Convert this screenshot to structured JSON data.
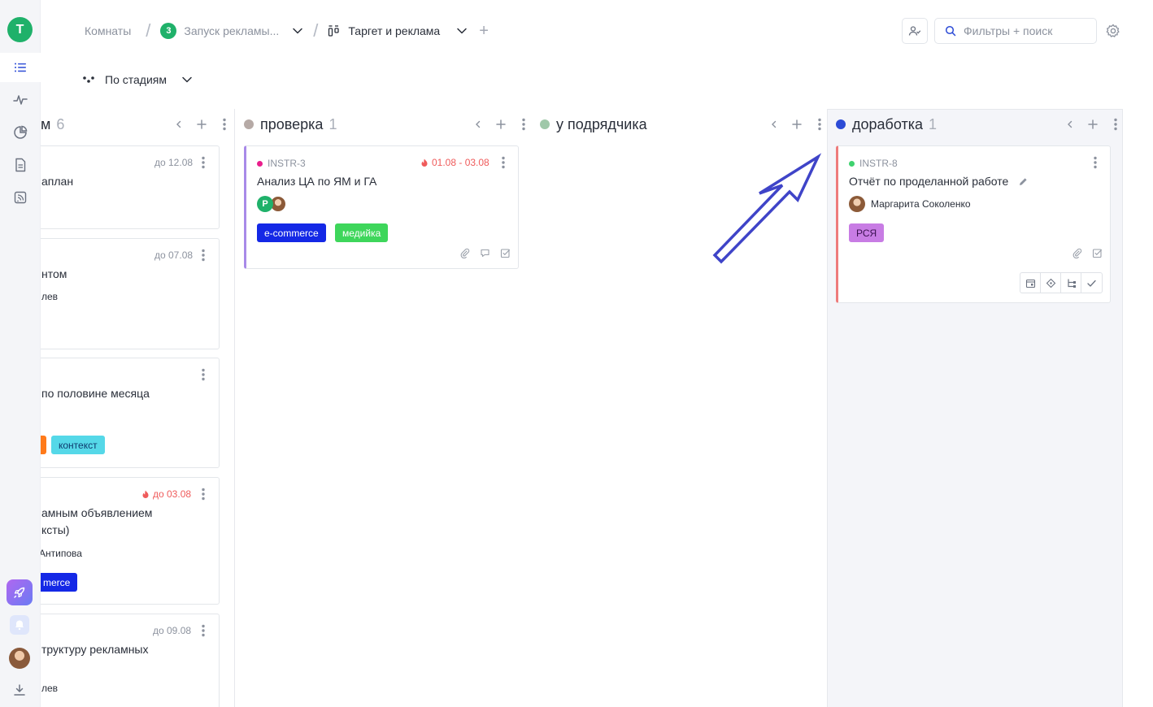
{
  "rail": {
    "workspace_letter": "T"
  },
  "header": {
    "breadcrumbs": {
      "rooms": "Комнаты",
      "project_badge": "3",
      "project": "Запуск рекламы...",
      "board": "Таргет и реклама"
    },
    "search_placeholder": "Фильтры + поиск",
    "group_by": "По стадиям"
  },
  "columns": [
    {
      "title": "м",
      "count": "6",
      "color": "#9aa0aa",
      "cards": [
        {
          "due": "до 12.08",
          "title": "аплан"
        },
        {
          "due": "до 07.08",
          "title": "нтом",
          "assignee": "лев"
        },
        {
          "title": "по половине месяца",
          "tags": [
            "контекст"
          ]
        },
        {
          "due": "до 03.08",
          "title": "амным объявлением\nксты)",
          "assignee": "Антипова",
          "tags": [
            "merce"
          ]
        },
        {
          "due": "до 09.08",
          "title": "труктуру рекламных",
          "assignee": "лев"
        }
      ]
    },
    {
      "title": "проверка",
      "count": "1",
      "color": "#b6aaa6",
      "cards": [
        {
          "code": "INSTR-3",
          "code_color": "#e91e8c",
          "due": "01.08 - 03.08",
          "title": "Анализ ЦА по ЯМ и ГА",
          "avatar_letter": "P",
          "tags": [
            "e-commerce",
            "медийка"
          ]
        }
      ]
    },
    {
      "title": "у подрядчика",
      "count": "",
      "color": "#9fc8a9",
      "cards": []
    },
    {
      "title": "доработка",
      "count": "1",
      "color": "#2c4bd6",
      "cards": [
        {
          "code": "INSTR-8",
          "code_color": "#3fd26f",
          "title": "Отчёт по проделанной работе",
          "assignee": "Маргарита Соколенко",
          "tags": [
            "РСЯ"
          ]
        }
      ]
    }
  ],
  "colors": {
    "accent_green": "#1fb16a",
    "tag_ecommerce": "#1428e6",
    "tag_media": "#3ed65b",
    "tag_context": "#55d8e8",
    "tag_rsya": "#c87ce4",
    "arrow": "#3f44c8"
  }
}
